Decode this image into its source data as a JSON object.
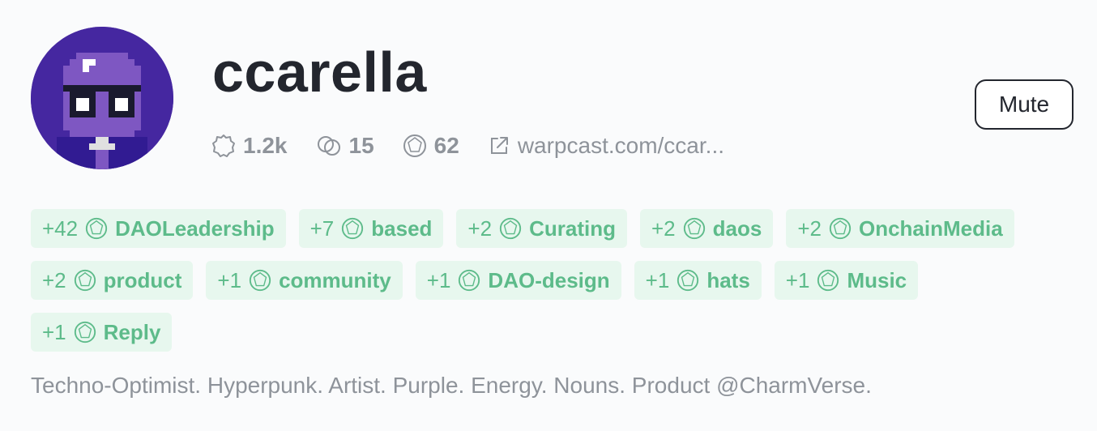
{
  "profile": {
    "username": "ccarella",
    "avatar_icon": "pixel-purple-noun-avatar",
    "bio": "Techno-Optimist. Hyperpunk. Artist. Purple. Energy. Nouns. Product @CharmVerse."
  },
  "stats": {
    "followers": "1.2k",
    "following": "15",
    "score": "62",
    "link": "warpcast.com/ccar..."
  },
  "actions": {
    "mute_label": "Mute"
  },
  "tags": [
    {
      "delta": "+42",
      "name": "DAOLeadership"
    },
    {
      "delta": "+7",
      "name": "based"
    },
    {
      "delta": "+2",
      "name": "Curating"
    },
    {
      "delta": "+2",
      "name": "daos"
    },
    {
      "delta": "+2",
      "name": "OnchainMedia"
    },
    {
      "delta": "+2",
      "name": "product"
    },
    {
      "delta": "+1",
      "name": "community"
    },
    {
      "delta": "+1",
      "name": "DAO-design"
    },
    {
      "delta": "+1",
      "name": "hats"
    },
    {
      "delta": "+1",
      "name": "Music"
    },
    {
      "delta": "+1",
      "name": "Reply"
    }
  ],
  "colors": {
    "text_dark": "#23262e",
    "text_muted": "#8e939a",
    "tag_bg": "#e7f7ee",
    "tag_text": "#5dbb8a",
    "avatar_bg": "#4527a0"
  }
}
